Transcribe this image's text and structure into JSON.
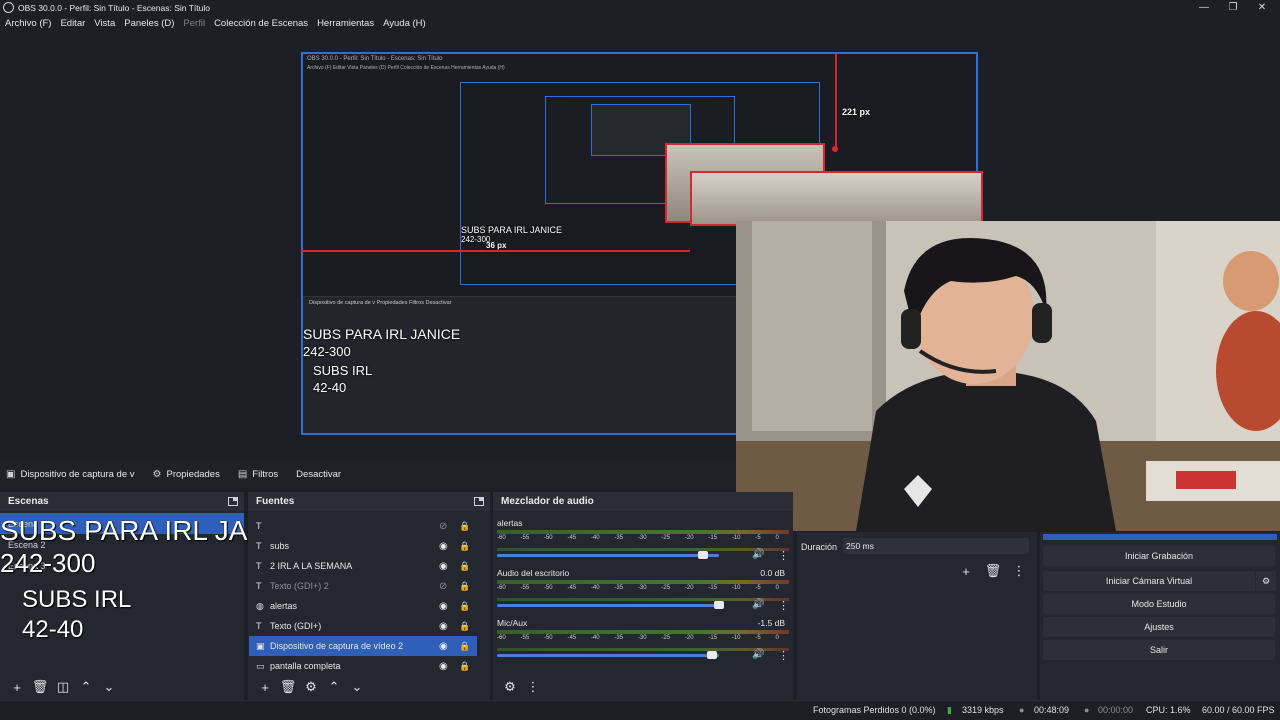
{
  "window": {
    "title": "OBS 30.0.0 - Perfil: Sin Título - Escenas: Sin Título",
    "controls": {
      "minimize": "—",
      "maximize": "❐",
      "close": "✕"
    }
  },
  "menu": [
    {
      "label": "Archivo (F)",
      "enabled": true
    },
    {
      "label": "Editar",
      "enabled": true
    },
    {
      "label": "Vista",
      "enabled": true
    },
    {
      "label": "Paneles (D)",
      "enabled": true
    },
    {
      "label": "Perfil",
      "enabled": false
    },
    {
      "label": "Colección de Escenas",
      "enabled": true
    },
    {
      "label": "Herramientas",
      "enabled": true
    },
    {
      "label": "Ayuda (H)",
      "enabled": true
    }
  ],
  "preview": {
    "nested_title": "OBS 30.0.0 - Perfil: Sin Título - Escenas: Sin Título",
    "nested_menu": "Archivo (F)   Editar   Vista   Paneles (D)   Perfil   Colección de Escenas   Herramientas   Ayuda (H)",
    "nested_dock_tabs": "Dispositivo de captura de v    Propiedades    Filtros    Desactivar",
    "measure_top": "221 px",
    "measure_left": "36 px",
    "nested_overlay": {
      "line1": "SUBS PARA IRL JANICE",
      "line2": "242-300",
      "line3": "SUBS IRL",
      "line4": "42-40"
    },
    "nested_overlay2": {
      "line1": "SUBS PARA IRL JANICE",
      "line2": "242-300",
      "line3": "SUBS IRL",
      "line4": "42-40"
    }
  },
  "source_toolbar": {
    "source_name": "Dispositivo de captura de v",
    "properties": "Propiedades",
    "filters": "Filtros",
    "deactivate": "Desactivar"
  },
  "scenes": {
    "title": "Escenas",
    "items": [
      "Escena",
      "Escena 2",
      "Escena 3"
    ]
  },
  "sources": {
    "title": "Fuentes",
    "items": [
      {
        "label": "",
        "icon": "text-icon",
        "visible": false,
        "locked": true
      },
      {
        "label": "subs",
        "icon": "text-icon",
        "visible": true,
        "locked": true
      },
      {
        "label": "2 IRL A LA SEMANA",
        "icon": "text-icon",
        "visible": true,
        "locked": true
      },
      {
        "label": "Texto (GDI+) 2",
        "icon": "text-icon",
        "visible": false,
        "locked": true
      },
      {
        "label": "alertas",
        "icon": "browser-icon",
        "visible": true,
        "locked": true
      },
      {
        "label": "Texto (GDI+)",
        "icon": "text-icon",
        "visible": true,
        "locked": true
      },
      {
        "label": "Dispositivo de captura de vídeo 2",
        "icon": "camera-icon",
        "visible": true,
        "locked": true
      },
      {
        "label": "pantalla completa",
        "icon": "monitor-icon",
        "visible": true,
        "locked": true
      }
    ]
  },
  "mixer": {
    "title": "Mezclador de audio",
    "scale": [
      "-60",
      "-55",
      "-50",
      "-45",
      "-40",
      "-35",
      "-30",
      "-25",
      "-20",
      "-15",
      "-10",
      "-5",
      "0"
    ],
    "tracks": [
      {
        "name": "alertas",
        "db": "",
        "volume": 0.93
      },
      {
        "name": "Audio del escritorio",
        "db": "0.0 dB",
        "volume": 1.0
      },
      {
        "name": "Mic/Aux",
        "db": "-1.5 dB",
        "volume": 0.97
      }
    ]
  },
  "transitions": {
    "duration_label": "Duración",
    "duration_value": "250 ms"
  },
  "controls": {
    "start_recording": "Iniciar Grabación",
    "start_virtual_cam": "Iniciar Cámara Virtual",
    "studio_mode": "Modo Estudio",
    "settings": "Ajustes",
    "exit": "Salir"
  },
  "overlay": {
    "line1": "SUBS PARA IRL JANICE",
    "line2": "242-300",
    "line3": "SUBS IRL",
    "line4": "42-40"
  },
  "status": {
    "dropped_frames": "Fotogramas Perdidos 0 (0.0%)",
    "bitrate": "3319 kbps",
    "stream_time": "00:48:09",
    "rec_time": "00:00:00",
    "cpu": "CPU: 1.6%",
    "fps": "60.00 / 60.00 FPS"
  },
  "colors": {
    "accent": "#2f5fb8",
    "selection_border": "#2f6fd8",
    "guide_red": "#d8262f",
    "bitrate_green": "#3fae3a"
  }
}
